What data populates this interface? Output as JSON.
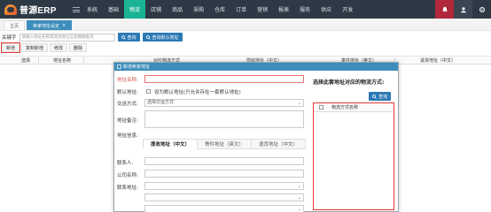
{
  "app": {
    "logo_text": "普源ERP"
  },
  "nav": {
    "items": [
      {
        "label": "系统",
        "active": false
      },
      {
        "label": "基础",
        "active": false
      },
      {
        "label": "物流",
        "active": true
      },
      {
        "label": "店铺",
        "active": false
      },
      {
        "label": "商品",
        "active": false
      },
      {
        "label": "采购",
        "active": false
      },
      {
        "label": "仓库",
        "active": false
      },
      {
        "label": "订单",
        "active": false
      },
      {
        "label": "营销",
        "active": false
      },
      {
        "label": "报表",
        "active": false
      },
      {
        "label": "服务",
        "active": false
      },
      {
        "label": "供应",
        "active": false
      },
      {
        "label": "开发",
        "active": false
      }
    ]
  },
  "tabs": [
    {
      "label": "主页"
    },
    {
      "label": "卖家地址设定",
      "close": "×"
    }
  ],
  "search": {
    "label": "关键字",
    "placeholder": "请输入地址名称或其他地址信息模糊查询",
    "query_button": "查询",
    "default_button": "查询默认地址"
  },
  "toolbar": {
    "add": "新增",
    "copy_add": "复制新增",
    "edit": "修改",
    "delete": "删除"
  },
  "table": {
    "columns": [
      "选择",
      "地址名称",
      "对应物流方式",
      "揽收地址（中文）",
      "寄件地址（英文）",
      "退货地址（中文）"
    ]
  },
  "modal": {
    "title": "新增卖家地址",
    "address_name_label": "地址名称:",
    "default_label": "默认地址:",
    "default_text": "设为默认地址(只允许存在一套默认地址)",
    "delivery_label": "交运方式:",
    "delivery_value": "选择交运方式",
    "remark_label": "地址备注:",
    "info_label": "地址信息:",
    "sub_tabs": [
      "揽收地址（中文）",
      "寄件地址（英文）",
      "退货地址（中文）"
    ],
    "contact_label": "联系人:",
    "company_label": "公司名称:",
    "contact_addr_label": "联系地址:"
  },
  "right_panel": {
    "title": "选择此套地址对应的物流方式:",
    "query_button": "查询",
    "column": "物流方式名称"
  }
}
